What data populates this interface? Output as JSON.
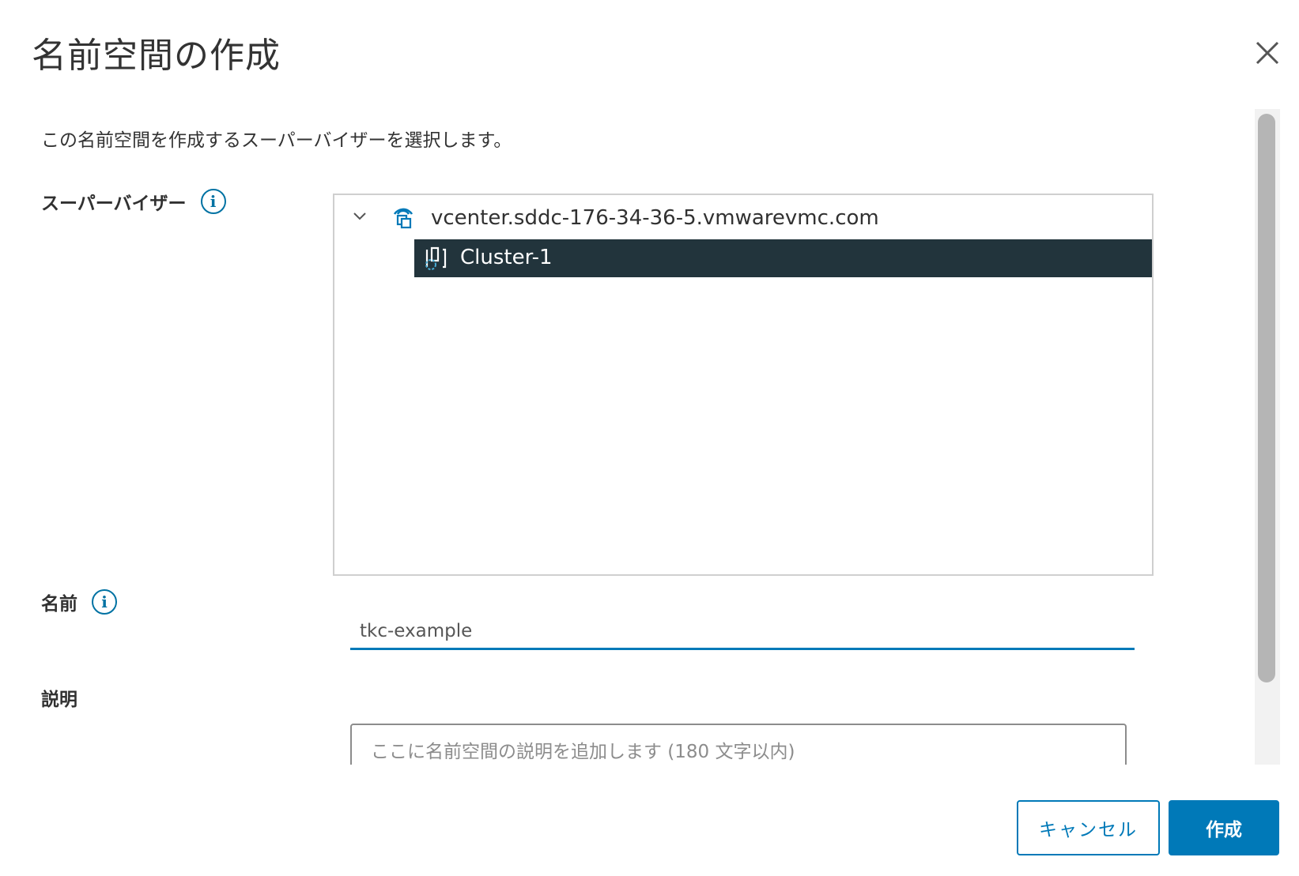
{
  "dialog": {
    "title": "名前空間の作成",
    "instruction": "この名前空間を作成するスーパーバイザーを選択します。"
  },
  "supervisor": {
    "label": "スーパーバイザー",
    "tree": {
      "parent": {
        "label": "vcenter.sddc-176-34-36-5.vmwarevmc.com",
        "icon": "vcenter-icon",
        "expanded": true
      },
      "children": [
        {
          "label": "Cluster-1",
          "icon": "cluster-icon",
          "selected": true
        }
      ]
    }
  },
  "name_field": {
    "label": "名前",
    "value": "tkc-example"
  },
  "description_field": {
    "label": "説明",
    "placeholder": "ここに名前空間の説明を追加します (180 文字以内)"
  },
  "buttons": {
    "cancel": "キャンセル",
    "create": "作成"
  },
  "colors": {
    "accent": "#0079b8",
    "selected_row": "#22343c",
    "info_icon": "#0072a3"
  }
}
